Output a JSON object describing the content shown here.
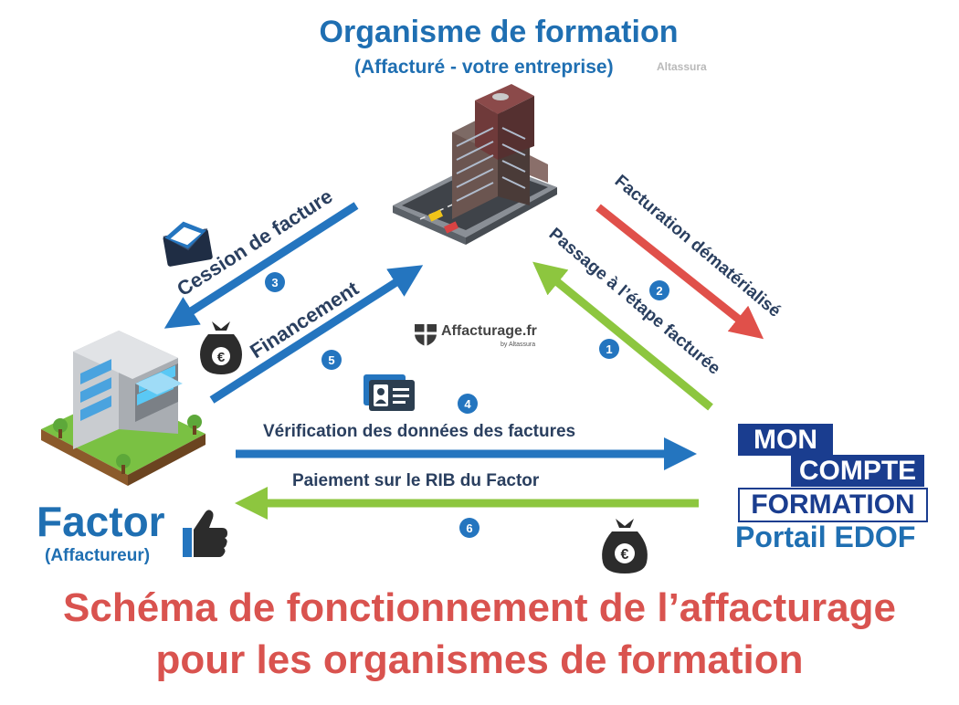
{
  "header": {
    "title": "Organisme de formation",
    "subtitle": "(Affacturé - votre entreprise)",
    "watermark": "Altassura"
  },
  "factor": {
    "title": "Factor",
    "subtitle": "(Affactureur)"
  },
  "portal": {
    "logo_line1": "MON",
    "logo_line2": "COMPTE",
    "logo_line3": "FORMATION",
    "label": "Portail EDOF"
  },
  "center_logo": {
    "name": "Affacturage.fr",
    "by": "by Altassura"
  },
  "flows": [
    {
      "step": "1",
      "label": "Passage à l’étape facturée",
      "color": "#8dc63f"
    },
    {
      "step": "2",
      "label": "Facturation dématérialisé",
      "color": "#e0504a"
    },
    {
      "step": "3",
      "label": "Cession de facture",
      "color": "#2475bf"
    },
    {
      "step": "4",
      "label": "Vérification des données des factures",
      "color": "#2475bf"
    },
    {
      "step": "5",
      "label": "Financement",
      "color": "#2475bf"
    },
    {
      "step": "6",
      "label": "Paiement sur le RIB du Factor",
      "color": "#8dc63f"
    }
  ],
  "footer": {
    "line1": "Schéma de fonctionnement de l’affacturage",
    "line2": "pour les organismes de formation"
  },
  "icons": [
    "office-tower-icon",
    "factor-building-icon",
    "envelope-icon",
    "money-bag-icon",
    "id-card-icon",
    "thumbs-up-icon",
    "shield-logo-icon"
  ]
}
